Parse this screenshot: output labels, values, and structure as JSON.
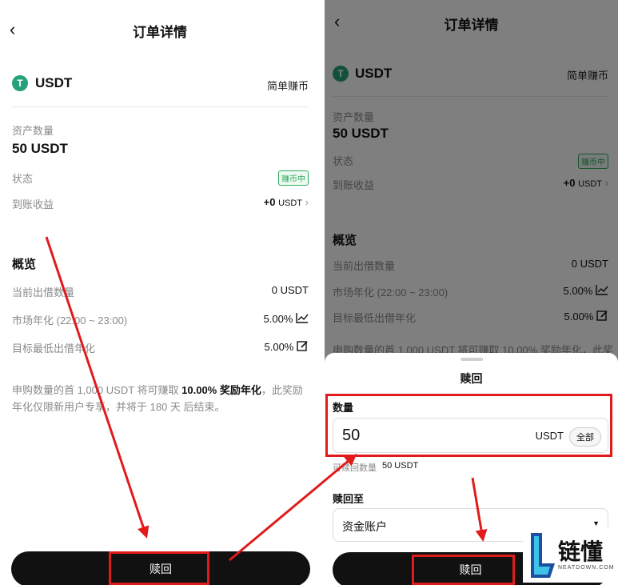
{
  "left": {
    "title": "订单详情",
    "coin": "USDT",
    "product": "简单赚币",
    "asset_label": "资产数量",
    "asset_value": "50 USDT",
    "status_label": "状态",
    "status_badge": "赚币中",
    "earnings_label": "到账收益",
    "earnings_value": "+0",
    "earnings_unit": "USDT",
    "overview": "概览",
    "lend_label": "当前出借数量",
    "lend_value": "0 USDT",
    "apr_label": "市场年化 (22:00 ~ 23:00)",
    "apr_value": "5.00%",
    "min_label": "目标最低出借年化",
    "min_value": "5.00%",
    "note_a": "申购数量的首 1,000 USDT 将可赚取 ",
    "note_b": "10.00% 奖励年化",
    "note_c": "，此奖励年化仅限新用户专享，并将于 180 天 后结束。",
    "button": "赎回"
  },
  "right": {
    "title": "订单详情",
    "coin": "USDT",
    "product": "简单赚币",
    "asset_label": "资产数量",
    "asset_value": "50 USDT",
    "status_label": "状态",
    "status_badge": "赚币中",
    "earnings_label": "到账收益",
    "earnings_value": "+0",
    "earnings_unit": "USDT",
    "overview": "概览",
    "lend_label": "当前出借数量",
    "lend_value": "0 USDT",
    "apr_label": "市场年化 (22:00 ~ 23:00)",
    "apr_value": "5.00%",
    "min_label": "目标最低出借年化",
    "min_value": "5.00%",
    "peek_text": "申购数量的首 1,000 USDT 将可赚取 10.00% 奖励年化，此奖",
    "sheet": {
      "title": "赎回",
      "qty_label": "数量",
      "qty_value": "50",
      "qty_unit": "USDT",
      "all_button": "全部",
      "redeemable_label": "可赎回数量",
      "redeemable_value": "50 USDT",
      "dest_label": "赎回至",
      "dest_value": "资金账户",
      "button": "赎回"
    }
  },
  "watermark": {
    "brand": "链懂",
    "site": "NEATDOWN.COM"
  },
  "colors": {
    "accent_green": "#2fa85f",
    "annotation_red": "#e11b1b",
    "button_black": "#111111",
    "tether": "#26a17b"
  }
}
